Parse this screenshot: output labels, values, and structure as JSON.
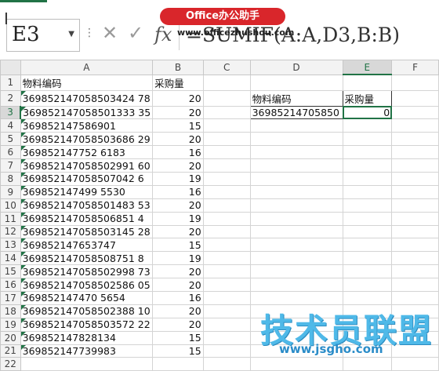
{
  "name_box": "E3",
  "formula": "=SUMIF(A:A,D3,B:B)",
  "fx_label": "fx",
  "watermark": {
    "badge": "Office办公助手",
    "badge_url": "www.officezhushou.com",
    "brand": "技术员联盟",
    "brand_url": "www.jsgho.com"
  },
  "columns": [
    "A",
    "B",
    "C",
    "D",
    "E",
    "F"
  ],
  "rows": [
    {
      "n": "1",
      "a": "物料编码",
      "b": "采购量",
      "d": "",
      "e": ""
    },
    {
      "n": "2",
      "a": "369852147058503424 78",
      "b": "20",
      "d": "物料编码",
      "e": "采购量"
    },
    {
      "n": "3",
      "a": "369852147058501333 35",
      "b": "20",
      "d": "36985214705850",
      "e": "0"
    },
    {
      "n": "4",
      "a": "369852147586901",
      "b": "15",
      "d": "",
      "e": ""
    },
    {
      "n": "5",
      "a": "369852147058503686 29",
      "b": "20",
      "d": "",
      "e": ""
    },
    {
      "n": "6",
      "a": "369852147752 6183",
      "b": "16",
      "d": "",
      "e": ""
    },
    {
      "n": "7",
      "a": "369852147058502991 60",
      "b": "20",
      "d": "",
      "e": ""
    },
    {
      "n": "8",
      "a": "369852147058507042 6",
      "b": "19",
      "d": "",
      "e": ""
    },
    {
      "n": "9",
      "a": "369852147499 5530",
      "b": "16",
      "d": "",
      "e": ""
    },
    {
      "n": "10",
      "a": "369852147058501483 53",
      "b": "20",
      "d": "",
      "e": ""
    },
    {
      "n": "11",
      "a": "369852147058506851 4",
      "b": "19",
      "d": "",
      "e": ""
    },
    {
      "n": "12",
      "a": "369852147058503145 28",
      "b": "20",
      "d": "",
      "e": ""
    },
    {
      "n": "13",
      "a": "369852147653747",
      "b": "15",
      "d": "",
      "e": ""
    },
    {
      "n": "14",
      "a": "369852147058508751 8",
      "b": "19",
      "d": "",
      "e": ""
    },
    {
      "n": "15",
      "a": "369852147058502998 73",
      "b": "20",
      "d": "",
      "e": ""
    },
    {
      "n": "16",
      "a": "369852147058502586 05",
      "b": "20",
      "d": "",
      "e": ""
    },
    {
      "n": "17",
      "a": "369852147470 5654",
      "b": "16",
      "d": "",
      "e": ""
    },
    {
      "n": "18",
      "a": "369852147058502388 10",
      "b": "20",
      "d": "",
      "e": ""
    },
    {
      "n": "19",
      "a": "369852147058503572 22",
      "b": "20",
      "d": "",
      "e": ""
    },
    {
      "n": "20",
      "a": "369852147828134",
      "b": "15",
      "d": "",
      "e": ""
    },
    {
      "n": "21",
      "a": "369852147739983",
      "b": "15",
      "d": "",
      "e": ""
    },
    {
      "n": "22",
      "a": "",
      "b": "",
      "d": "",
      "e": ""
    }
  ]
}
